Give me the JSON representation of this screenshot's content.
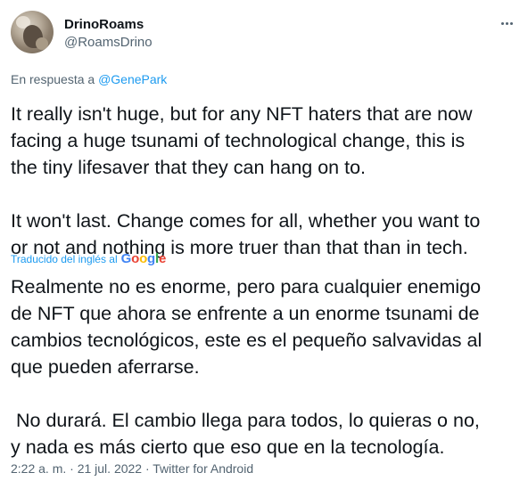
{
  "tweet": {
    "author_name": "DrinoRoams",
    "author_handle": "@RoamsDrino",
    "reply_prefix": "En respuesta a",
    "reply_mention": "@GenePark",
    "original_text": "It really isn't huge, but for any NFT haters that are now\nfacing a huge tsunami of technological change, this is\nthe tiny lifesaver that they can hang on to.\n\nIt won't last. Change comes for all, whether you want to\nor not and nothing is more truer than that than in tech.",
    "translation_label": "Traducido del inglés al",
    "translation_provider": {
      "g1": "G",
      "o1": "o",
      "o2": "o",
      "g2": "g",
      "l": "l",
      "e": "e"
    },
    "translated_text": "Realmente no es enorme, pero para cualquier enemigo\nde NFT que ahora se enfrente a un enorme tsunami de\ncambios tecnológicos, este es el pequeño salvavidas al\nque pueden aferrarse.\n\n No durará. El cambio llega para todos, lo quieras o no,\ny nada es más cierto que eso que en la tecnología.",
    "timestamp": "2:22 a. m. · 21 jul. 2022 · Twitter for Android"
  },
  "icons": {
    "avatar": "profile-photo",
    "more": "more-horizontal-icon"
  },
  "colors": {
    "link": "#1d9bf0",
    "secondary_text": "#536471",
    "primary_text": "#0f1419"
  }
}
